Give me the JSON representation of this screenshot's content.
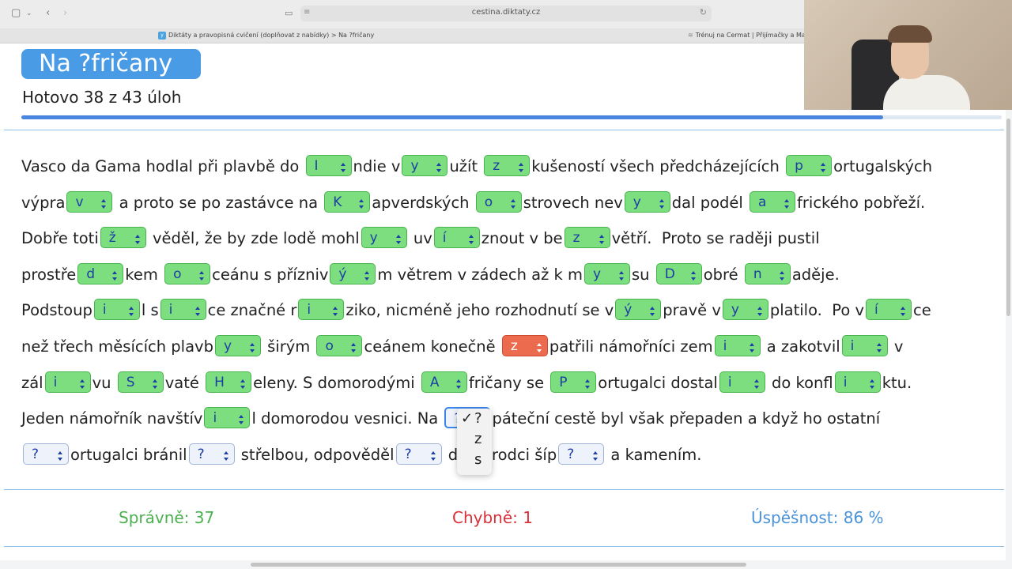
{
  "browser": {
    "url": "cestina.diktaty.cz",
    "tabs": [
      {
        "favicon": "y",
        "label": "Diktáty a pravopisná cvičení (doplňovat z nabídky) > Na ?fričany"
      },
      {
        "favicon": "",
        "label": "Trénuj na Cermat | Přijímačky a Maturi"
      }
    ]
  },
  "header": {
    "title": "Na ?fričany",
    "progress_text": "Hotovo 38 z 43 úloh",
    "progress_fraction": 0.879
  },
  "exercise": {
    "lines": [
      [
        {
          "t": "Vasco da Gama hodlal při plavbě do "
        },
        {
          "g": "I",
          "s": "correct"
        },
        {
          "t": "ndie v"
        },
        {
          "g": "y",
          "s": "correct"
        },
        {
          "t": "užít "
        },
        {
          "g": "z",
          "s": "correct"
        },
        {
          "t": "kušeností všech předcházejících "
        },
        {
          "g": "p",
          "s": "correct"
        },
        {
          "t": "ortugalských"
        }
      ],
      [
        {
          "t": "výpra"
        },
        {
          "g": "v",
          "s": "correct"
        },
        {
          "t": " a proto se po zastávce na "
        },
        {
          "g": "K",
          "s": "correct"
        },
        {
          "t": "apverdských "
        },
        {
          "g": "o",
          "s": "correct"
        },
        {
          "t": "strovech nev"
        },
        {
          "g": "y",
          "s": "correct"
        },
        {
          "t": "dal podél "
        },
        {
          "g": "a",
          "s": "correct"
        },
        {
          "t": "frického pobřeží."
        }
      ],
      [
        {
          "t": "Dobře toti"
        },
        {
          "g": "ž",
          "s": "correct"
        },
        {
          "t": " věděl, že by zde lodě mohl"
        },
        {
          "g": "y",
          "s": "correct"
        },
        {
          "t": " uv"
        },
        {
          "g": "í",
          "s": "correct"
        },
        {
          "t": "znout v be"
        },
        {
          "g": "z",
          "s": "correct"
        },
        {
          "t": "větří.  Proto se raději pustil"
        }
      ],
      [
        {
          "t": "prostře"
        },
        {
          "g": "d",
          "s": "correct"
        },
        {
          "t": "kem "
        },
        {
          "g": "o",
          "s": "correct"
        },
        {
          "t": "ceánu s přízniv"
        },
        {
          "g": "ý",
          "s": "correct"
        },
        {
          "t": "m větrem v zádech až k m"
        },
        {
          "g": "y",
          "s": "correct"
        },
        {
          "t": "su "
        },
        {
          "g": "D",
          "s": "correct"
        },
        {
          "t": "obré "
        },
        {
          "g": "n",
          "s": "correct"
        },
        {
          "t": "aděje."
        }
      ],
      [
        {
          "t": "Podstoup"
        },
        {
          "g": "i",
          "s": "correct"
        },
        {
          "t": "l s"
        },
        {
          "g": "i",
          "s": "correct"
        },
        {
          "t": "ce značné r"
        },
        {
          "g": "i",
          "s": "correct"
        },
        {
          "t": "ziko, nicméně jeho rozhodnutí se v"
        },
        {
          "g": "ý",
          "s": "correct"
        },
        {
          "t": "pravě v"
        },
        {
          "g": "y",
          "s": "correct"
        },
        {
          "t": "platilo.  Po v"
        },
        {
          "g": "í",
          "s": "correct"
        },
        {
          "t": "ce"
        }
      ],
      [
        {
          "t": "než třech měsících plavb"
        },
        {
          "g": "y",
          "s": "correct"
        },
        {
          "t": " širým "
        },
        {
          "g": "o",
          "s": "correct"
        },
        {
          "t": "ceánem konečně "
        },
        {
          "g": "z",
          "s": "wrong"
        },
        {
          "t": "patřili námořníci zem"
        },
        {
          "g": "i",
          "s": "correct"
        },
        {
          "t": " a zakotvil"
        },
        {
          "g": "i",
          "s": "correct"
        },
        {
          "t": " v"
        }
      ],
      [
        {
          "t": "zál"
        },
        {
          "g": "i",
          "s": "correct"
        },
        {
          "t": "vu "
        },
        {
          "g": "S",
          "s": "correct"
        },
        {
          "t": "vaté "
        },
        {
          "g": "H",
          "s": "correct"
        },
        {
          "t": "eleny. S domorodými "
        },
        {
          "g": "A",
          "s": "correct"
        },
        {
          "t": "fričany se "
        },
        {
          "g": "P",
          "s": "correct"
        },
        {
          "t": "ortugalci dostal"
        },
        {
          "g": "i",
          "s": "correct"
        },
        {
          "t": " do konfl"
        },
        {
          "g": "i",
          "s": "correct"
        },
        {
          "t": "ktu."
        }
      ],
      [
        {
          "t": "Jeden námořník navštív"
        },
        {
          "g": "i",
          "s": "correct"
        },
        {
          "t": "l domorodou vesnici. Na "
        },
        {
          "g": "?",
          "s": "active"
        },
        {
          "t": "páteční cestě byl však přepaden a když ho ostatní"
        }
      ],
      [
        {
          "g": "?",
          "s": "empty"
        },
        {
          "t": "ortugalci bránil"
        },
        {
          "g": "?",
          "s": "empty"
        },
        {
          "t": " střelbou, odpověděl"
        },
        {
          "g": "?",
          "s": "empty"
        },
        {
          "t": " domorodci šíp"
        },
        {
          "g": "?",
          "s": "empty"
        },
        {
          "t": " a kamením."
        }
      ]
    ]
  },
  "dropdown": {
    "options": [
      "?",
      "z",
      "s"
    ],
    "selected": "?",
    "check_mark": "✓"
  },
  "stats": {
    "correct": "Správně: 37",
    "wrong": "Chybně: 1",
    "success": "Úspěšnost: 86 %",
    "colors": {
      "correct": "#4cb050",
      "wrong": "#d9303a",
      "success": "#4a93d9"
    }
  }
}
